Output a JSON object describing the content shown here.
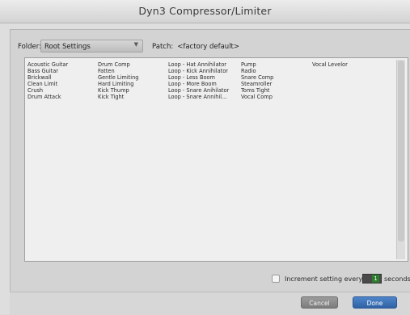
{
  "window": {
    "title": "Dyn3 Compressor/Limiter"
  },
  "folder": {
    "label": "Folder:",
    "value": "Root Settings"
  },
  "patch": {
    "label": "Patch:",
    "value": "<factory default>"
  },
  "presets": {
    "col1": [
      "Acoustic Guitar",
      "Bass Guitar",
      "Brickwall",
      "Clean Limit",
      "Crush",
      "Drum Attack"
    ],
    "col2": [
      "Drum Comp",
      "Fatten",
      "Gentle Limiting",
      "Hard Limiting",
      "Kick Thump",
      "Kick Tight"
    ],
    "col3": [
      "Loop - Hat Annihilator",
      "Loop - Kick Annihilator",
      "Loop - Less Boom",
      "Loop - More Boom",
      "Loop - Snare Anihilator",
      "Loop - Snare Annihil..."
    ],
    "col4": [
      "Pump",
      "Radio",
      "Snare Comp",
      "Steamroller",
      "Toms Tight",
      "Vocal Comp"
    ],
    "col5": [
      "Vocal Levelor"
    ]
  },
  "increment": {
    "label": "Increment setting every",
    "value": "1",
    "unit": "seconds",
    "checked": false
  },
  "buttons": {
    "cancel": "Cancel",
    "done": "Done"
  },
  "colors": {
    "done_button": "#3a6fb5",
    "counter_fill": "#2e7d2e"
  }
}
